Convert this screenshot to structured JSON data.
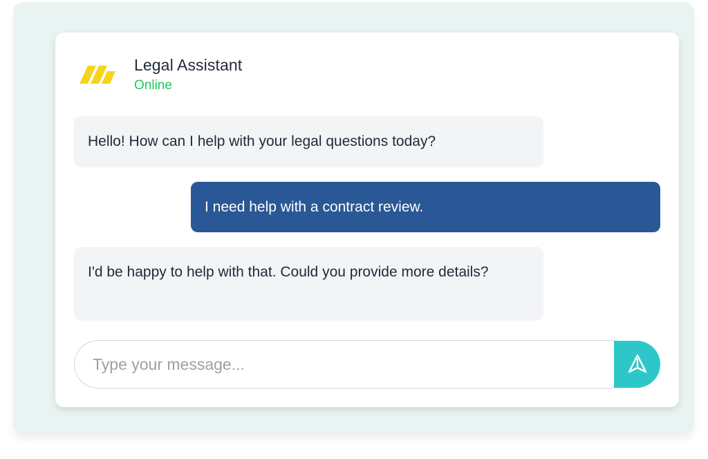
{
  "header": {
    "title": "Legal Assistant",
    "status": "Online",
    "status_color": "#22c55e",
    "logo_icon": "brand-logo-icon",
    "logo_color": "#f7d31b"
  },
  "messages": [
    {
      "sender": "bot",
      "text": "Hello! How can I help with your legal questions today?"
    },
    {
      "sender": "user",
      "text": "I need help with a contract review."
    },
    {
      "sender": "bot",
      "text": "I'd be happy to help with that. Could you provide more details?"
    }
  ],
  "composer": {
    "placeholder": "Type your message...",
    "value": "",
    "send_icon": "send-icon",
    "send_color": "#2ec7c9"
  },
  "colors": {
    "user_bubble": "#2a5896",
    "bot_bubble": "#f3f4f6",
    "outer_background": "#e9f4f2"
  }
}
